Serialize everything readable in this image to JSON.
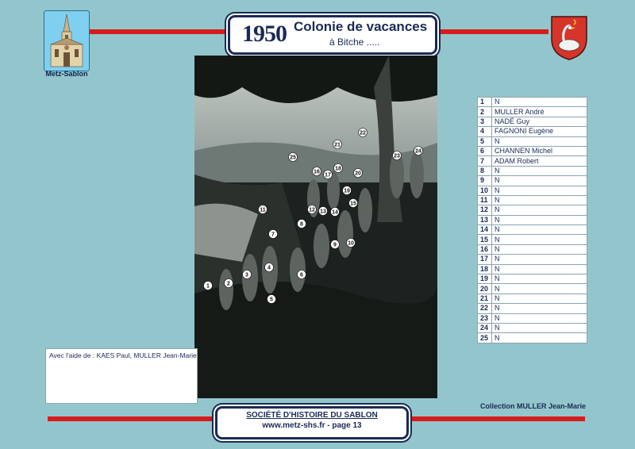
{
  "header": {
    "year": "1950",
    "title": "Colonie de vacances",
    "subtitle": "à Bitche ....."
  },
  "logo_caption": "Metz-Sablon",
  "colors": {
    "background": "#93c6cc",
    "accent_red": "#d81c1c",
    "navy": "#1b2a55"
  },
  "photo_labels": [
    "1",
    "2",
    "3",
    "4",
    "5",
    "6",
    "7",
    "8",
    "9",
    "10",
    "11",
    "12",
    "13",
    "14",
    "15",
    "16",
    "17",
    "18",
    "19",
    "20",
    "21",
    "22",
    "23",
    "24",
    "25"
  ],
  "names": [
    {
      "num": "1",
      "name": "N"
    },
    {
      "num": "2",
      "name": "MULLER André"
    },
    {
      "num": "3",
      "name": "NADÉ Guy"
    },
    {
      "num": "4",
      "name": "FAGNONI Eugène"
    },
    {
      "num": "5",
      "name": "N"
    },
    {
      "num": "6",
      "name": "CHANNEN Michel"
    },
    {
      "num": "7",
      "name": "ADAM Robert"
    },
    {
      "num": "8",
      "name": "N"
    },
    {
      "num": "9",
      "name": "N"
    },
    {
      "num": "10",
      "name": "N"
    },
    {
      "num": "11",
      "name": "N"
    },
    {
      "num": "12",
      "name": "N"
    },
    {
      "num": "13",
      "name": "N"
    },
    {
      "num": "14",
      "name": "N"
    },
    {
      "num": "15",
      "name": "N"
    },
    {
      "num": "16",
      "name": "N"
    },
    {
      "num": "17",
      "name": "N"
    },
    {
      "num": "18",
      "name": "N"
    },
    {
      "num": "19",
      "name": "N"
    },
    {
      "num": "20",
      "name": "N"
    },
    {
      "num": "21",
      "name": "N"
    },
    {
      "num": "22",
      "name": "N"
    },
    {
      "num": "23",
      "name": "N"
    },
    {
      "num": "24",
      "name": "N"
    },
    {
      "num": "25",
      "name": "N"
    }
  ],
  "help_text": "Avec l'aide de : KAES Paul, MULLER Jean-Marie",
  "collection": "Collection MULLER Jean-Marie",
  "footer": {
    "society": "SOCIÉTÉ D'HISTOIRE DU SABLON",
    "site_page": "www.metz-shs.fr  -  page 13"
  }
}
